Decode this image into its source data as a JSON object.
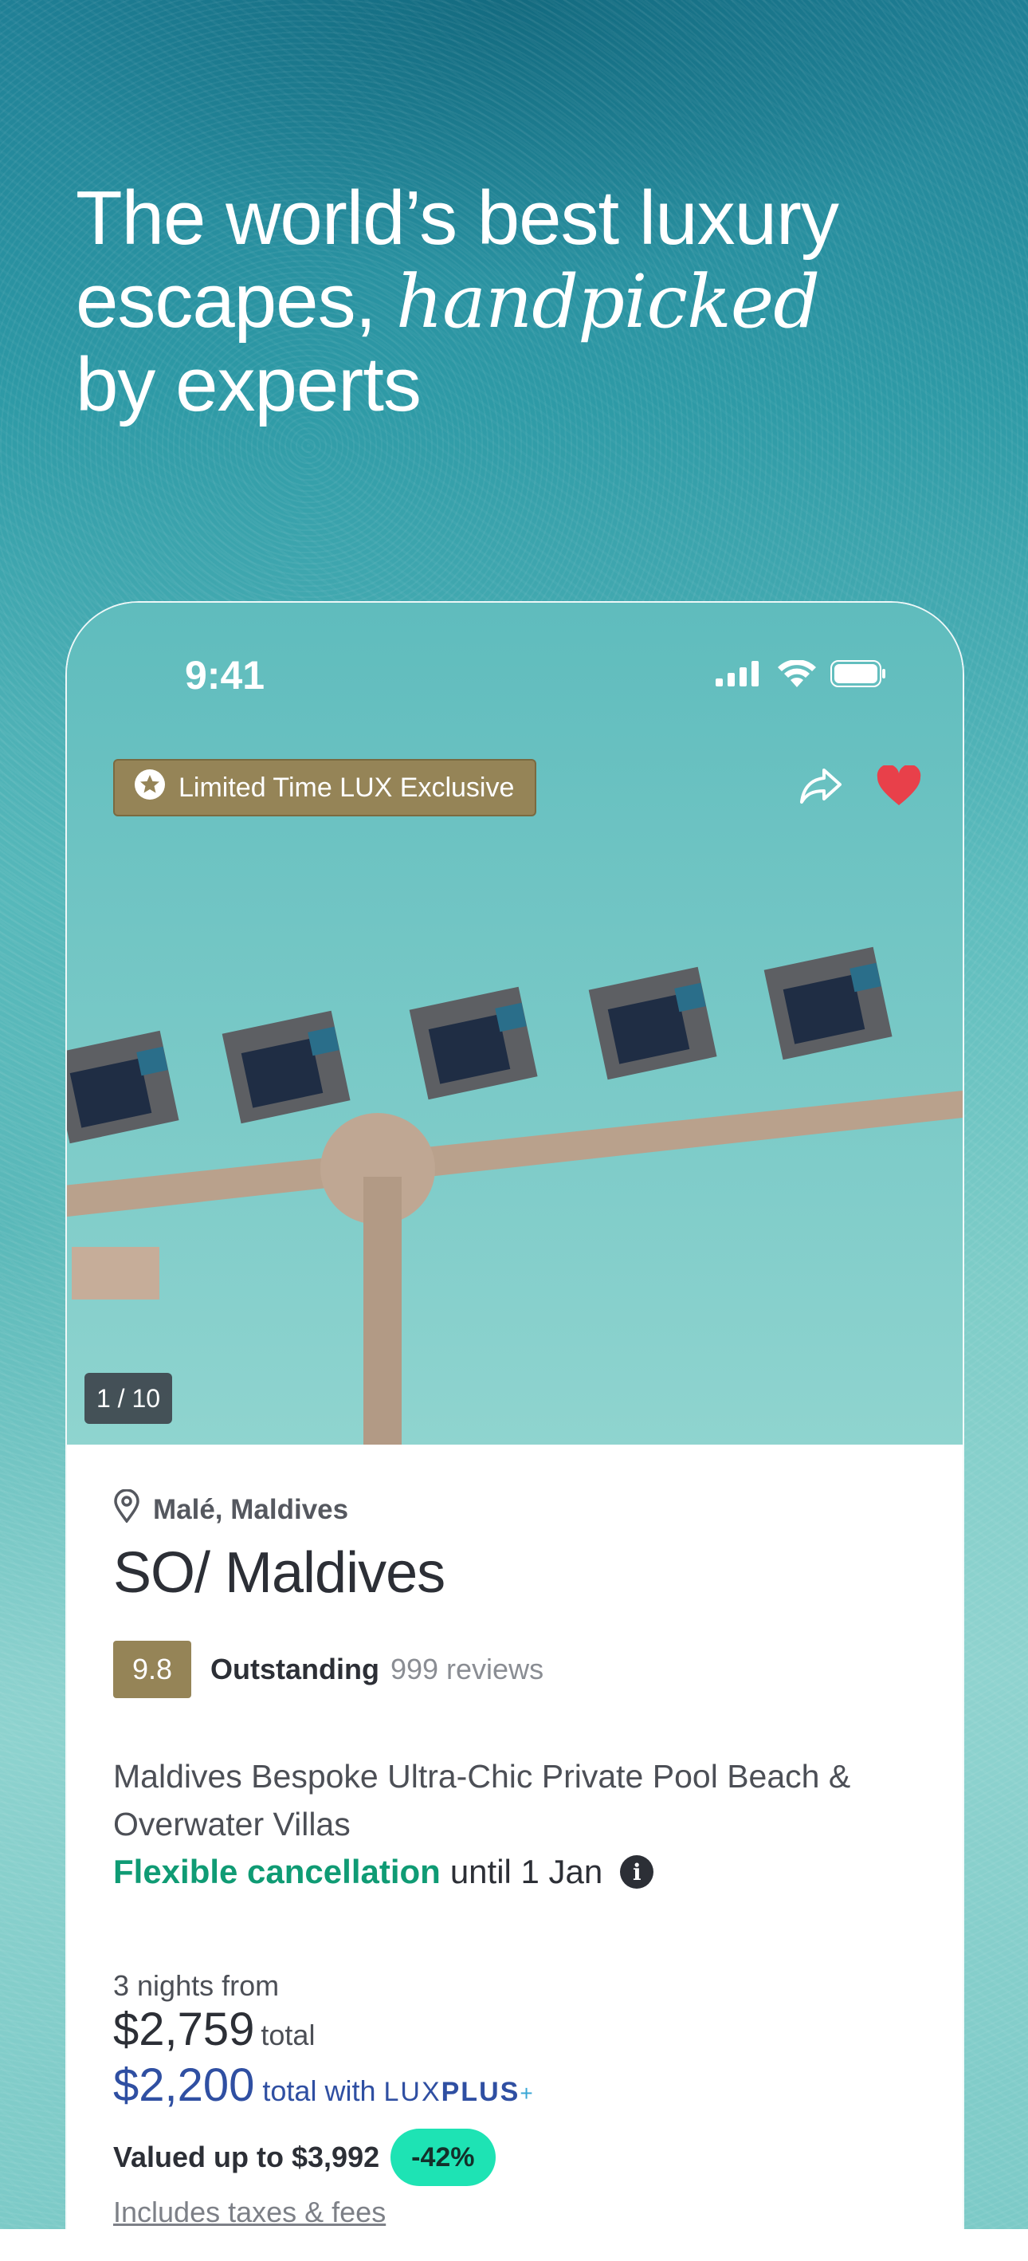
{
  "headline": {
    "line1": "The world’s best luxury",
    "line2_prefix": "escapes, ",
    "line2_italic": "handpicked",
    "line3": "by experts"
  },
  "status_bar": {
    "time": "9:41",
    "icons": [
      "signal-icon",
      "wifi-icon",
      "battery-icon"
    ]
  },
  "listing": {
    "badge": {
      "icon": "star-circle-icon",
      "label": "Limited Time LUX Exclusive"
    },
    "actions": {
      "share_icon": "share-icon",
      "favorite_icon": "heart-icon",
      "favorite_color": "#e8404a"
    },
    "photo_counter": "1 / 10",
    "location": "Malé, Maldives",
    "name": "SO/ Maldives",
    "rating": {
      "score": "9.8",
      "label": "Outstanding",
      "reviews": "999 reviews"
    },
    "description": "Maldives Bespoke Ultra-Chic Private Pool Beach & Overwater Villas",
    "cancellation": {
      "highlight": "Flexible cancellation",
      "rest": "until 1 Jan"
    },
    "pricing": {
      "nights_label": "3 nights from",
      "price": "$2,759",
      "price_suffix": "total",
      "member_price": "$2,200",
      "member_suffix": "total with",
      "brand_lux": "LUX",
      "brand_plus": "PLUS",
      "brand_plus_sign": "+",
      "valued": "Valued up to $3,992",
      "discount": "-42%",
      "taxes_note": "Includes taxes & fees"
    }
  },
  "colors": {
    "badge_gold": "#958457",
    "cancel_green": "#0f9b74",
    "member_blue": "#2f4fa2",
    "discount_mint": "#1ee3b4"
  }
}
